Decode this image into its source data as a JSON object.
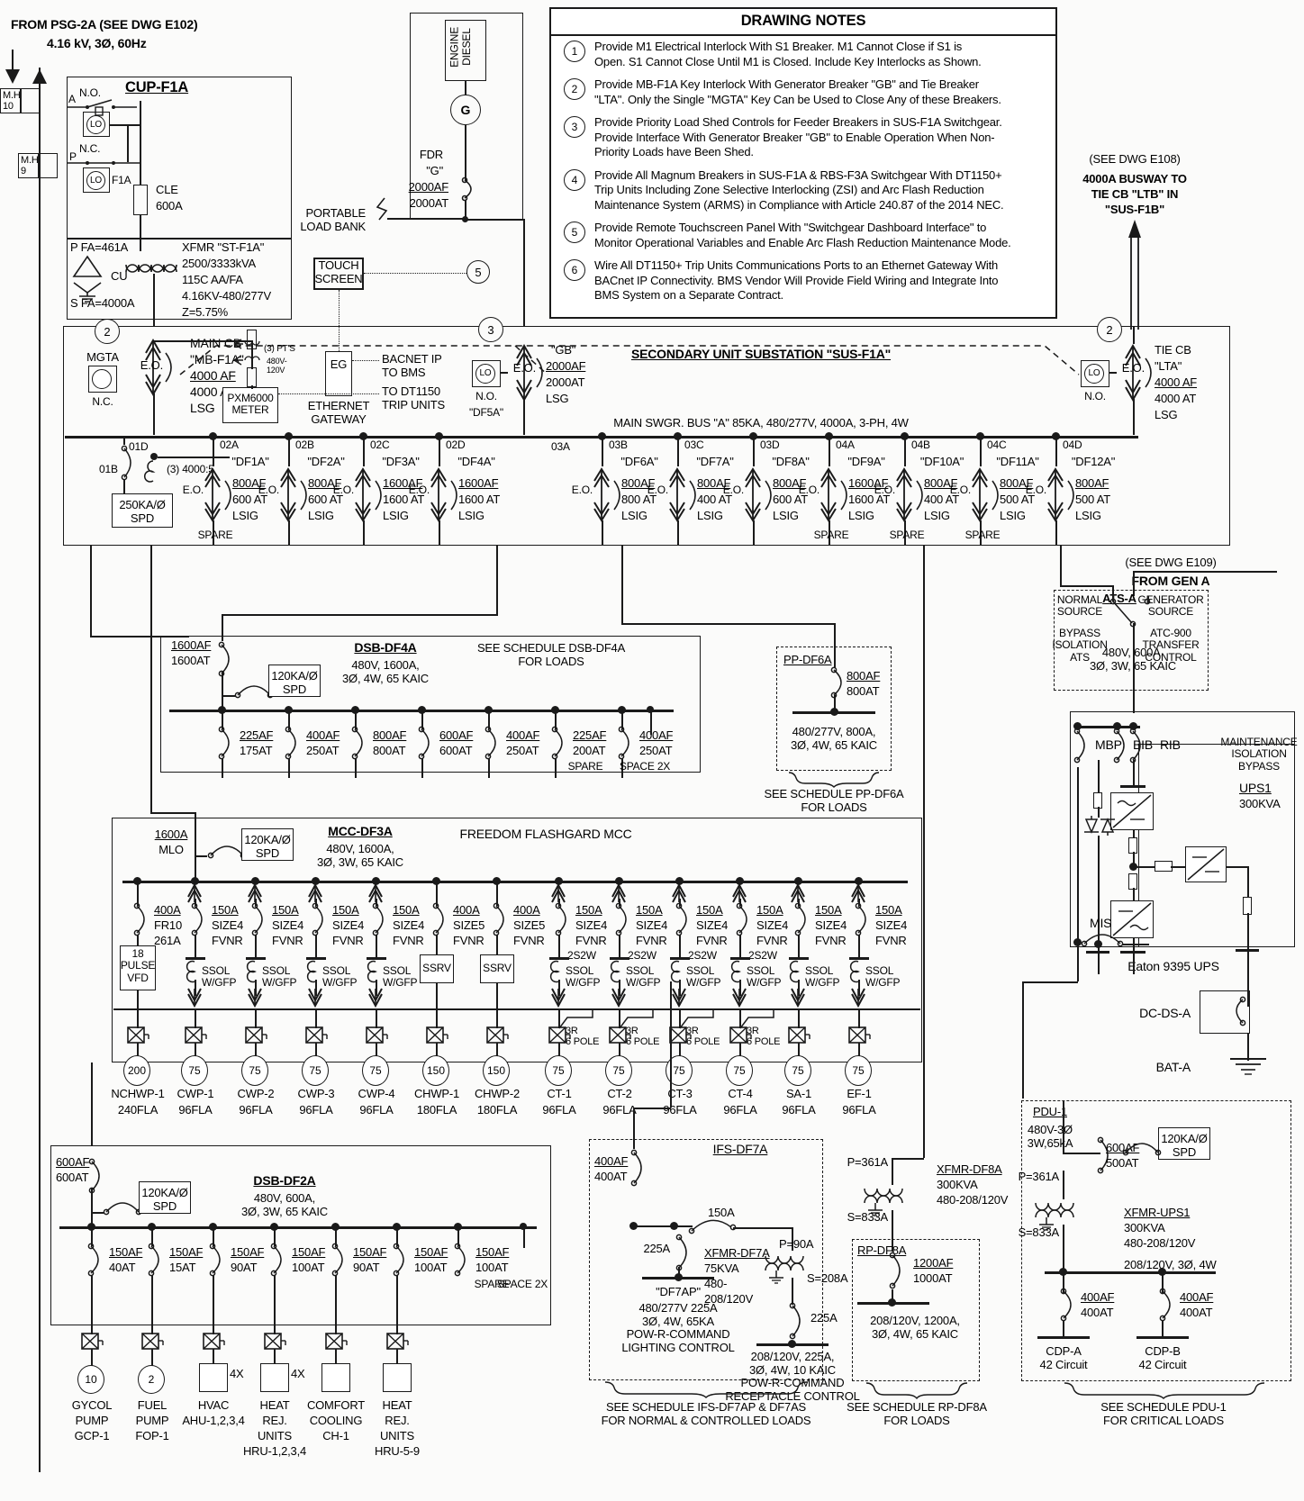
{
  "source": {
    "from": "FROM PSG-2A (SEE DWG E102)",
    "voltage": "4.16 kV, 3Ø, 60Hz",
    "mh10": "M.H\n10",
    "mh9": "M.H\n9"
  },
  "cup": {
    "title": "CUP-F1A",
    "no": "N.O.",
    "nc": "N.C.",
    "a": "A",
    "p": "P",
    "lo": "LO",
    "f1a": "F1A",
    "cle": "CLE",
    "cle_rating": "600A",
    "pfa": "P FA=461A",
    "sfa": "S FA=4000A",
    "cu": "CU",
    "xfmr_name": "XFMR \"ST-F1A\"",
    "xfmr_kva": "2500/3333kVA",
    "xfmr_temp": "115C AA/FA",
    "xfmr_volt": "4.16KV-480/277V",
    "xfmr_z": "Z=5.75%"
  },
  "engine": {
    "label": "ENGINE\nDIESEL",
    "gen_symbol": "G",
    "fdr": "FDR",
    "fdr_tag": "\"G\"",
    "fdr_af": "2000AF",
    "fdr_at": "2000AT",
    "portable": "PORTABLE\nLOAD BANK",
    "touchscreen": "TOUCH\nSCREEN",
    "touch_note": "5"
  },
  "notes": {
    "title": "DRAWING NOTES",
    "items": [
      {
        "n": "1",
        "text": "Provide M1 Electrical Interlock With S1 Breaker. M1 Cannot Close if S1 is\nOpen. S1 Cannot Close Until M1 is Closed. Include Key Interlocks as Shown."
      },
      {
        "n": "2",
        "text": "Provide MB-F1A Key Interlock With Generator Breaker \"GB\" and Tie Breaker\n\"LTA\". Only the Single \"MGTA\" Key Can be Used to Close Any of these Breakers."
      },
      {
        "n": "3",
        "text": "Provide Priority Load Shed Controls for Feeder Breakers in SUS-F1A Switchgear.\nProvide Interface With Generator Breaker \"GB\" to Enable Operation When Non-\nPriority Loads have Been Shed."
      },
      {
        "n": "4",
        "text": "Provide All Magnum Breakers in SUS-F1A & RBS-F3A Switchgear With DT1150+\nTrip Units Including Zone Selective Interlocking (ZSI) and Arc Flash Reduction\nMaintenance System (ARMS) in Compliance with Article 240.87 of the 2014 NEC."
      },
      {
        "n": "5",
        "text": "Provide Remote Touchscreen Panel With \"Switchgear Dashboard Interface\" to\nMonitor Operational Variables and Enable Arc Flash Reduction Maintenance Mode."
      },
      {
        "n": "6",
        "text": "Wire All DT1150+ Trip Units Communications Ports to an Ethernet Gateway With\nBACnet IP Connectivity. BMS Vendor Will Provide Field Wiring and Integrate Into\nBMS System on a Separate Contract."
      }
    ]
  },
  "busway": {
    "dwg": "(SEE DWG E108)",
    "line1": "4000A BUSWAY TO",
    "line2": "TIE CB \"LTB\" IN",
    "line3": "\"SUS-F1B\""
  },
  "switchgear": {
    "title": "SECONDARY UNIT SUBSTATION \"SUS-F1A\"",
    "bus_label": "MAIN SWGR. BUS \"A\" 85KA, 480/277V, 4000A, 3-PH, 4W",
    "mgta": "MGTA",
    "mgta_nc": "N.C.",
    "main_cb": "MAIN CB",
    "main_tag": "\"MB-F1A\"",
    "main_af": "4000 AF",
    "main_at": "4000 AT",
    "main_lsg": "LSG",
    "eo": "E.O.",
    "pts": "(3) PT'S",
    "pts_v": "480V-\n120V",
    "meter": "PXM6000\nMETER",
    "ct": "(3) 4000:5",
    "cell_01b": "01B",
    "cell_01d": "01D",
    "eg": "EG",
    "eg_label": "ETHERNET\nGATEWAY",
    "bacnet": "BACNET IP\nTO BMS",
    "dt1150": "TO DT1150\nTRIP UNITS",
    "spd_main": "250KA/Ø\nSPD",
    "gb_lo": "LO",
    "gb_no": "N.O.",
    "gb_df5a": "\"DF5A\"",
    "gb_tag": "\"GB\"",
    "gb_af": "2000AF",
    "gb_at": "2000AT",
    "gb_lsg": "LSG",
    "tie_title": "TIE CB",
    "tie_tag": "\"LTA\"",
    "tie_af": "4000 AF",
    "tie_at": "4000 AT",
    "tie_lsg": "LSG",
    "tie_no": "N.O.",
    "tie_lo": "LO",
    "feeders": [
      {
        "cell": "02A",
        "tag": "\"DF1A\"",
        "af": "800AF",
        "at": "600 AT",
        "trip": "LSIG",
        "spare": "SPARE"
      },
      {
        "cell": "02B",
        "tag": "\"DF2A\"",
        "af": "800AF",
        "at": "600 AT",
        "trip": "LSIG",
        "spare": ""
      },
      {
        "cell": "02C",
        "tag": "\"DF3A\"",
        "af": "1600AF",
        "at": "1600 AT",
        "trip": "LSIG",
        "spare": ""
      },
      {
        "cell": "02D",
        "tag": "\"DF4A\"",
        "af": "1600AF",
        "at": "1600 AT",
        "trip": "LSIG",
        "spare": ""
      },
      {
        "cell": "03B",
        "tag": "\"DF6A\"",
        "af": "800AF",
        "at": "800 AT",
        "trip": "LSIG",
        "spare": ""
      },
      {
        "cell": "03C",
        "tag": "\"DF7A\"",
        "af": "800AF",
        "at": "400 AT",
        "trip": "LSIG",
        "spare": ""
      },
      {
        "cell": "03D",
        "tag": "\"DF8A\"",
        "af": "800AF",
        "at": "600 AT",
        "trip": "LSIG",
        "spare": ""
      },
      {
        "cell": "04A",
        "tag": "\"DF9A\"",
        "af": "1600AF",
        "at": "1600 AT",
        "trip": "LSIG",
        "spare": "SPARE"
      },
      {
        "cell": "04B",
        "tag": "\"DF10A\"",
        "af": "800AF",
        "at": "400 AT",
        "trip": "LSIG",
        "spare": "SPARE"
      },
      {
        "cell": "04C",
        "tag": "\"DF11A\"",
        "af": "800AF",
        "at": "500 AT",
        "trip": "LSIG",
        "spare": "SPARE"
      },
      {
        "cell": "04D",
        "tag": "\"DF12A\"",
        "af": "800AF",
        "at": "500 AT",
        "trip": "LSIG",
        "spare": ""
      }
    ],
    "cell_03a": "03A"
  },
  "dsb_df4a": {
    "main_af": "1600AF",
    "main_at": "1600AT",
    "spd": "120KA/Ø\nSPD",
    "title": "DSB-DF4A",
    "rating": "480V, 1600A,\n3Ø, 4W, 65 KAIC",
    "schedule": "SEE SCHEDULE DSB-DF4A\nFOR LOADS",
    "branches": [
      {
        "af": "225AF",
        "at": "175AT"
      },
      {
        "af": "400AF",
        "at": "250AT"
      },
      {
        "af": "800AF",
        "at": "800AT"
      },
      {
        "af": "600AF",
        "at": "600AT"
      },
      {
        "af": "400AF",
        "at": "250AT"
      },
      {
        "af": "225AF",
        "at": "200AT"
      },
      {
        "af": "400AF",
        "at": "250AT"
      }
    ],
    "spare": "SPARE",
    "space": "SPACE 2X"
  },
  "pp_df6a": {
    "title": "PP-DF6A",
    "af": "800AF",
    "at": "800AT",
    "rating": "480/277V, 800A,\n3Ø, 4W, 65 KAIC",
    "schedule": "SEE SCHEDULE PP-DF6A\nFOR LOADS"
  },
  "mcc": {
    "main": "1600A",
    "mlo": "MLO",
    "spd": "120KA/Ø\nSPD",
    "title": "MCC-DF3A",
    "rating": "480V, 1600A,\n3Ø, 3W, 65 KAIC",
    "brand": "FREEDOM FLASHGARD MCC",
    "starters": [
      {
        "amp": "400A",
        "size": "FR10",
        "type": "261A",
        "ol": "",
        "device": "18\nPULSE\nVFD",
        "hp": "200",
        "name": "NCHWP-1",
        "fla": "240FLA",
        "pole": ""
      },
      {
        "amp": "150A",
        "size": "SIZE4",
        "type": "FVNR",
        "ol": "SSOL\nW/GFP",
        "device": "",
        "hp": "75",
        "name": "CWP-1",
        "fla": "96FLA",
        "pole": ""
      },
      {
        "amp": "150A",
        "size": "SIZE4",
        "type": "FVNR",
        "ol": "SSOL\nW/GFP",
        "device": "",
        "hp": "75",
        "name": "CWP-2",
        "fla": "96FLA",
        "pole": ""
      },
      {
        "amp": "150A",
        "size": "SIZE4",
        "type": "FVNR",
        "ol": "SSOL\nW/GFP",
        "device": "",
        "hp": "75",
        "name": "CWP-3",
        "fla": "96FLA",
        "pole": ""
      },
      {
        "amp": "150A",
        "size": "SIZE4",
        "type": "FVNR",
        "ol": "SSOL\nW/GFP",
        "device": "",
        "hp": "75",
        "name": "CWP-4",
        "fla": "96FLA",
        "pole": ""
      },
      {
        "amp": "400A",
        "size": "SIZE5",
        "type": "FVNR",
        "ol": "",
        "device": "SSRV",
        "hp": "150",
        "name": "CHWP-1",
        "fla": "180FLA",
        "pole": ""
      },
      {
        "amp": "400A",
        "size": "SIZE5",
        "type": "FVNR",
        "ol": "",
        "device": "SSRV",
        "hp": "150",
        "name": "CHWP-2",
        "fla": "180FLA",
        "pole": ""
      },
      {
        "amp": "150A",
        "size": "SIZE4",
        "type": "FVNR",
        "ol": "SSOL\nW/GFP",
        "device": "2S2W",
        "hp": "75",
        "name": "CT-1",
        "fla": "96FLA",
        "pole": "3R\n6 POLE"
      },
      {
        "amp": "150A",
        "size": "SIZE4",
        "type": "FVNR",
        "ol": "SSOL\nW/GFP",
        "device": "2S2W",
        "hp": "75",
        "name": "CT-2",
        "fla": "96FLA",
        "pole": "3R\n6 POLE"
      },
      {
        "amp": "150A",
        "size": "SIZE4",
        "type": "FVNR",
        "ol": "SSOL\nW/GFP",
        "device": "2S2W",
        "hp": "75",
        "name": "CT-3",
        "fla": "96FLA",
        "pole": "3R\n6 POLE"
      },
      {
        "amp": "150A",
        "size": "SIZE4",
        "type": "FVNR",
        "ol": "SSOL\nW/GFP",
        "device": "2S2W",
        "hp": "75",
        "name": "CT-4",
        "fla": "96FLA",
        "pole": "3R\n6 POLE"
      },
      {
        "amp": "150A",
        "size": "SIZE4",
        "type": "FVNR",
        "ol": "SSOL\nW/GFP",
        "device": "",
        "hp": "75",
        "name": "SA-1",
        "fla": "96FLA",
        "pole": ""
      },
      {
        "amp": "150A",
        "size": "SIZE4",
        "type": "FVNR",
        "ol": "SSOL\nW/GFP",
        "device": "",
        "hp": "75",
        "name": "EF-1",
        "fla": "96FLA",
        "pole": ""
      }
    ]
  },
  "dsb_df2a": {
    "main_af": "600AF",
    "main_at": "600AT",
    "spd": "120KA/Ø\nSPD",
    "title": "DSB-DF2A",
    "rating": "480V, 600A,\n3Ø, 3W, 65 KAIC",
    "branches": [
      {
        "af": "150AF",
        "at": "40AT",
        "hp": "10",
        "name": "GYCOL\nPUMP\nGCP-1",
        "box": ""
      },
      {
        "af": "150AF",
        "at": "15AT",
        "hp": "2",
        "name": "FUEL\nPUMP\nFOP-1",
        "box": ""
      },
      {
        "af": "150AF",
        "at": "90AT",
        "hp": "",
        "name": "HVAC\nAHU-1,2,3,4",
        "box": "4X"
      },
      {
        "af": "150AF",
        "at": "100AT",
        "hp": "",
        "name": "HEAT\nREJ.\nUNITS\nHRU-1,2,3,4",
        "box": "4X"
      },
      {
        "af": "150AF",
        "at": "90AT",
        "hp": "",
        "name": "COMFORT\nCOOLING\nCH-1",
        "box": ""
      },
      {
        "af": "150AF",
        "at": "100AT",
        "hp": "",
        "name": "HEAT\nREJ.\nUNITS\nHRU-5-9",
        "box": ""
      },
      {
        "af": "150AF",
        "at": "100AT",
        "hp": "",
        "name": "",
        "box": ""
      }
    ],
    "spare": "SPARE",
    "space": "SPACE 2X"
  },
  "ifs_df7a": {
    "title": "IFS-DF7A",
    "main_af": "400AF",
    "main_at": "400AT",
    "br_150": "150A",
    "br_225": "225A",
    "xfmr_name": "XFMR-DF7A",
    "xfmr_kva": "75KVA",
    "xfmr_v1": "480-",
    "xfmr_v2": "208/120V",
    "p_amp": "P=90A",
    "s_amp": "S=208A",
    "sec_br": "225A",
    "panel1_tag": "\"DF7AP\"",
    "panel1_desc": "480/277V 225A\n3Ø, 4W, 65KA\nPOW-R-COMMAND\nLIGHTING CONTROL",
    "panel2_desc": "208/120V, 225A,\n3Ø, 4W, 10 KAIC\nPOW-R-COMMAND\nRECEPTACLE CONTROL",
    "schedule": "SEE SCHEDULE IFS-DF7AP & DF7AS\nFOR NORMAL & CONTROLLED LOADS"
  },
  "rp_df8a": {
    "title": "RP-DF8A",
    "p_amp": "P=361A",
    "s_amp": "S=833A",
    "xfmr_name": "XFMR-DF8A",
    "xfmr_kva": "300KVA",
    "xfmr_v": "480-208/120V",
    "br_af": "1200AF",
    "br_at": "1000AT",
    "panel_desc": "208/120V, 1200A,\n3Ø, 4W, 65 KAIC",
    "schedule": "SEE SCHEDULE RP-DF8A\nFOR LOADS"
  },
  "ats": {
    "dwg": "(SEE DWG E109)",
    "from_gen": "FROM GEN A",
    "title": "ATS-A",
    "normal": "NORMAL\nSOURCE",
    "generator": "GENERATOR\nSOURCE",
    "bypass": "BYPASS\nISOLATION\nATS",
    "control": "ATC-900\nTRANSFER\nCONTROL",
    "rating": "480V, 600A,\n3Ø, 3W, 65 KAIC"
  },
  "ups": {
    "mib_title": "MAINTENANCE\nISOLATION\nBYPASS",
    "mbp": "MBP",
    "bib": "BIB",
    "rib": "RIB",
    "mis": "MIS",
    "title": "UPS1",
    "kva": "300KVA",
    "brand": "Eaton 9395 UPS",
    "dc_ds": "DC-DS-A",
    "bat": "BAT-A"
  },
  "pdu": {
    "title": "PDU-1",
    "volt": "480V-3Ø\n3W,65kA",
    "br_af": "600AF",
    "br_at": "500AT",
    "spd": "120KA/Ø\nSPD",
    "p_amp": "P=361A",
    "s_amp": "S=833A",
    "xfmr_name": "XFMR-UPS1",
    "xfmr_kva": "300KVA",
    "xfmr_v": "480-208/120V",
    "sec_rating": "208/120V, 3Ø, 4W",
    "cdp_a_af": "400AF",
    "cdp_a_at": "400AT",
    "cdp_b_af": "400AF",
    "cdp_b_at": "400AT",
    "cdp_a": "CDP-A\n42 Circuit",
    "cdp_b": "CDP-B\n42 Circuit",
    "schedule": "SEE SCHEDULE PDU-1\nFOR CRITICAL LOADS"
  },
  "refs": {
    "e109": "(SEE DWG E109)"
  }
}
